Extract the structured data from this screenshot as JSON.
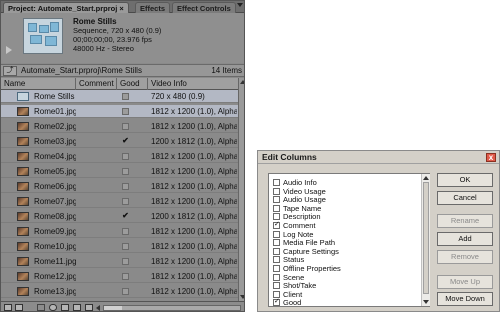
{
  "project_panel": {
    "tabs": [
      "Project: Automate_Start.prproj",
      "Effects",
      "Effect Controls"
    ],
    "tab_close": "×",
    "preview": {
      "title": "Rome Stills",
      "line1": "Sequence, 720 x 480 (0.9)",
      "line2": "00;00;00;00, 23.976 fps",
      "line3": "48000 Hz - Stereo"
    },
    "path": "Automate_Start.prproj\\Rome Stills",
    "item_count": "14 Items",
    "columns": [
      "Name",
      "Comment",
      "Good",
      "Video Info"
    ],
    "rows": [
      {
        "name": "Rome Stills",
        "good": false,
        "info": "720 x 480 (0.9)",
        "type": "sequence"
      },
      {
        "name": "Rome01.jpg",
        "good": false,
        "info": "1812 x 1200 (1.0), Alpha",
        "type": "image"
      },
      {
        "name": "Rome02.jpg",
        "good": false,
        "info": "1812 x 1200 (1.0), Alpha",
        "type": "image"
      },
      {
        "name": "Rome03.jpg",
        "good": true,
        "info": "1200 x 1812 (1.0), Alpha",
        "type": "image"
      },
      {
        "name": "Rome04.jpg",
        "good": false,
        "info": "1812 x 1200 (1.0), Alpha",
        "type": "image"
      },
      {
        "name": "Rome05.jpg",
        "good": false,
        "info": "1812 x 1200 (1.0), Alpha",
        "type": "image"
      },
      {
        "name": "Rome06.jpg",
        "good": false,
        "info": "1812 x 1200 (1.0), Alpha",
        "type": "image"
      },
      {
        "name": "Rome07.jpg",
        "good": false,
        "info": "1812 x 1200 (1.0), Alpha",
        "type": "image"
      },
      {
        "name": "Rome08.jpg",
        "good": true,
        "info": "1200 x 1812 (1.0), Alpha",
        "type": "image"
      },
      {
        "name": "Rome09.jpg",
        "good": false,
        "info": "1812 x 1200 (1.0), Alpha",
        "type": "image"
      },
      {
        "name": "Rome10.jpg",
        "good": false,
        "info": "1812 x 1200 (1.0), Alpha",
        "type": "image"
      },
      {
        "name": "Rome11.jpg",
        "good": false,
        "info": "1812 x 1200 (1.0), Alpha",
        "type": "image"
      },
      {
        "name": "Rome12.jpg",
        "good": false,
        "info": "1812 x 1200 (1.0), Alpha",
        "type": "image"
      },
      {
        "name": "Rome13.jpg",
        "good": false,
        "info": "1812 x 1200 (1.0), Alpha",
        "type": "image"
      }
    ],
    "check_mark": "✔"
  },
  "edit_columns": {
    "title": "Edit Columns",
    "close_glyph": "x",
    "items": [
      {
        "label": "Audio Info",
        "checked": false
      },
      {
        "label": "Video Usage",
        "checked": false
      },
      {
        "label": "Audio Usage",
        "checked": false
      },
      {
        "label": "Tape Name",
        "checked": false
      },
      {
        "label": "Description",
        "checked": false
      },
      {
        "label": "Comment",
        "checked": true
      },
      {
        "label": "Log Note",
        "checked": false
      },
      {
        "label": "Media File Path",
        "checked": false
      },
      {
        "label": "Capture Settings",
        "checked": false
      },
      {
        "label": "Status",
        "checked": false
      },
      {
        "label": "Offline Properties",
        "checked": false
      },
      {
        "label": "Scene",
        "checked": false
      },
      {
        "label": "Shot/Take",
        "checked": false
      },
      {
        "label": "Client",
        "checked": false
      },
      {
        "label": "Good",
        "checked": true
      }
    ],
    "buttons": {
      "ok": "OK",
      "cancel": "Cancel",
      "rename": "Rename",
      "add": "Add",
      "remove": "Remove",
      "move_up": "Move Up",
      "move_down": "Move Down"
    }
  }
}
